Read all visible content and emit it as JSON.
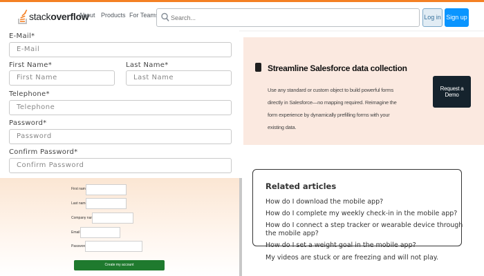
{
  "header": {
    "logo_text_light": "stack",
    "logo_text_bold": "overflow",
    "nav": [
      "About",
      "Products",
      "For Teams"
    ],
    "search_placeholder": "Search...",
    "login_label": "Log in",
    "signup_label": "Sign up",
    "accent_color": "#f48024"
  },
  "form": {
    "email_label": "E-Mail*",
    "email_placeholder": "E-Mail",
    "first_name_label": "First Name*",
    "first_name_placeholder": "First Name",
    "last_name_label": "Last Name*",
    "last_name_placeholder": "Last Name",
    "telephone_label": "Telephone*",
    "telephone_placeholder": "Telephone",
    "password_label": "Password*",
    "password_placeholder": "Password",
    "confirm_label": "Confirm Password*",
    "confirm_placeholder": "Confirm Password"
  },
  "banner": {
    "title": "Streamline Salesforce data collection",
    "body": "Use any standard or custom object to build powerful forms directly in Salesforce—no mapping required. Reimagine the form experience by dynamically prefilling forms with your existing data.",
    "cta": "Request a Demo"
  },
  "mini_form": {
    "first_name": "First name",
    "last_name": "Last name",
    "company": "Company name",
    "email": "Email",
    "password": "Password",
    "submit": "Create my account",
    "button_color": "#1f7a2e"
  },
  "related": {
    "title": "Related articles",
    "links": [
      "How do I download the mobile app?",
      "How do I complete my weekly check-in in the mobile app?",
      "How do I connect a step tracker or wearable device through the mobile app?",
      "How do I set a weight goal in the mobile app?",
      "My videos are stuck or are freezing and will not play."
    ]
  }
}
